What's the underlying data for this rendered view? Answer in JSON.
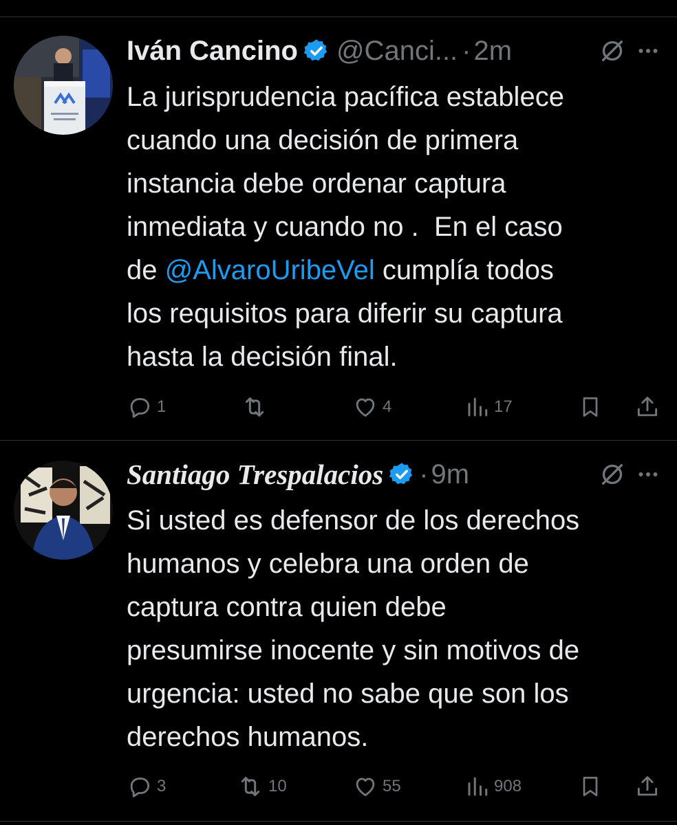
{
  "tweets": [
    {
      "author": {
        "name": "Iván Cancino",
        "handle": "@Canci...",
        "time": "2m",
        "verified": true
      },
      "text_lines": [
        "La jurisprudencia pacífica establece",
        "cuando una decisión de primera",
        "instancia debe ordenar captura",
        "inmediata y cuando no .  En el caso"
      ],
      "line5": {
        "before": "de ",
        "mention": "@AlvaroUribeVel",
        "after": " cumplía todos"
      },
      "text_lines_end": [
        "los requisitos para diferir su captura",
        "hasta la decisión final."
      ],
      "stats": {
        "replies": "1",
        "reposts": "",
        "likes": "4",
        "views": "17"
      }
    },
    {
      "author": {
        "name": "Santiago Trespalacios",
        "time": "9m",
        "verified": true
      },
      "text_lines": [
        "Si usted es defensor de los derechos",
        "humanos y celebra una orden de",
        "captura contra quien debe",
        "presumirse inocente y sin motivos de",
        "urgencia: usted no sabe que son los",
        "derechos humanos."
      ],
      "stats": {
        "replies": "3",
        "reposts": "10",
        "likes": "55",
        "views": "908"
      }
    }
  ],
  "icons": {
    "verified": "verified-badge-icon",
    "grok": "grok-icon",
    "more": "more-options-icon",
    "reply": "reply-icon",
    "repost": "repost-icon",
    "like": "like-icon",
    "views": "views-icon",
    "bookmark": "bookmark-icon",
    "share": "share-icon"
  },
  "colors": {
    "background": "#000000",
    "text": "#e7e9ea",
    "secondary": "#71767b",
    "accent": "#1d9bf0",
    "divider": "#2f3336"
  }
}
